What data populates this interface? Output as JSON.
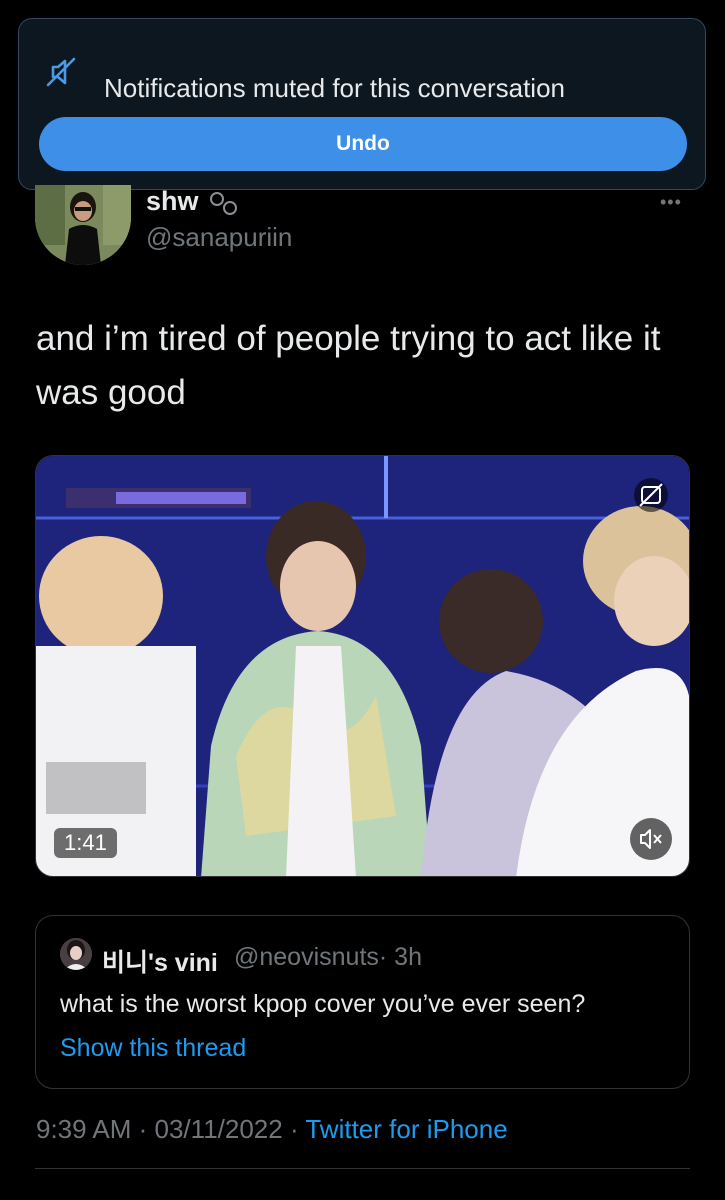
{
  "toast": {
    "icon": "muted-bell-icon",
    "message": "Notifications muted for this conversation",
    "undo_label": "Undo"
  },
  "tweet": {
    "display_name": "shw",
    "handle": "@sanapuriin",
    "text": "and i’m tired of people trying to act like it was good",
    "more_icon": "ellipsis-icon",
    "video": {
      "duration": "1:41",
      "mute_icon": "speaker-muted-icon",
      "cc_icon": "closed-captions-icon"
    },
    "meta": {
      "time": "9:39 AM",
      "sep1": " · ",
      "date": "03/11/2022",
      "sep2": " · ",
      "source": "Twitter for iPhone"
    }
  },
  "quoted_tweet": {
    "display_name": "비니's vini",
    "handle": "@neovisnuts",
    "time": "· 3h",
    "text": "what is the worst kpop cover you’ve ever seen?",
    "show_thread": "Show this thread"
  },
  "colors": {
    "accent": "#1d9bf0",
    "undo_button": "#3d8fe8",
    "background": "#000000"
  }
}
